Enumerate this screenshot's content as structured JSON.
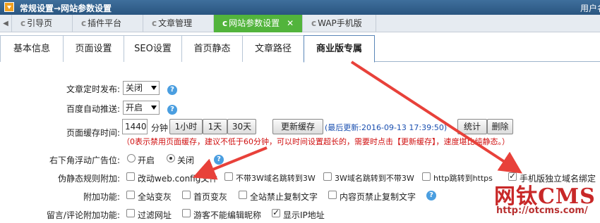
{
  "titlebar": {
    "title": "常规设置→网站参数设置",
    "user": "用户名"
  },
  "pagetabs": {
    "prev_arrow": "◀",
    "items": [
      {
        "label": "引导页"
      },
      {
        "label": "插件平台"
      },
      {
        "label": "文章管理"
      },
      {
        "label": "网站参数设置",
        "close": "✕"
      },
      {
        "label": "WAP手机版"
      }
    ]
  },
  "settabs": [
    "基本信息",
    "页面设置",
    "SEO设置",
    "首页静态",
    "文章路径",
    "商业版专属"
  ],
  "form": {
    "timed_publish": {
      "label": "文章定时发布:",
      "value": "关闭"
    },
    "baidu_push": {
      "label": "百度自动推送:",
      "value": "开启"
    },
    "cache": {
      "label": "页面缓存时间:",
      "value": "1440",
      "unit": "分钟",
      "btn_1h": "1小时",
      "btn_1d": "1天",
      "btn_30d": "30天",
      "refresh_btn": "更新缓存",
      "last_update": "(最后更新:2016-09-13 17:39:50)",
      "stats_btn": "统计",
      "delete_btn": "删除",
      "note": "（0表示禁用页面缓存，建议不低于60分钟，可以时间设置超长的，需要时点击【更新缓存】，速度堪比纯静态。）"
    },
    "float_ad": {
      "label": "右下角浮动广告位:",
      "opt_on": "开启",
      "opt_off": "关闭"
    },
    "pseudo_static": {
      "label": "伪静态规则附加:",
      "opts": [
        "改动web.config文件",
        "不带3W域名跳转到3W",
        "3W域名跳转到不带3W",
        "http跳转到https",
        "手机版独立域名绑定"
      ]
    },
    "extra": {
      "label": "附加功能:",
      "opts": [
        "全站变灰",
        "首页变灰",
        "全站禁止复制文字",
        "内容页禁止复制文字"
      ]
    },
    "comment": {
      "label": "留言/评论附加功能:",
      "opts": [
        "过滤网址",
        "游客不能编辑昵称",
        "显示IP地址"
      ]
    }
  },
  "help_glyph": "?",
  "watermark": {
    "brand": "网钛CMS",
    "url": "http://otcms.com/"
  },
  "colors": {
    "active_tab": "#52b43c",
    "arrow": "#e8413a",
    "titlebar": "#2f5f8c"
  }
}
